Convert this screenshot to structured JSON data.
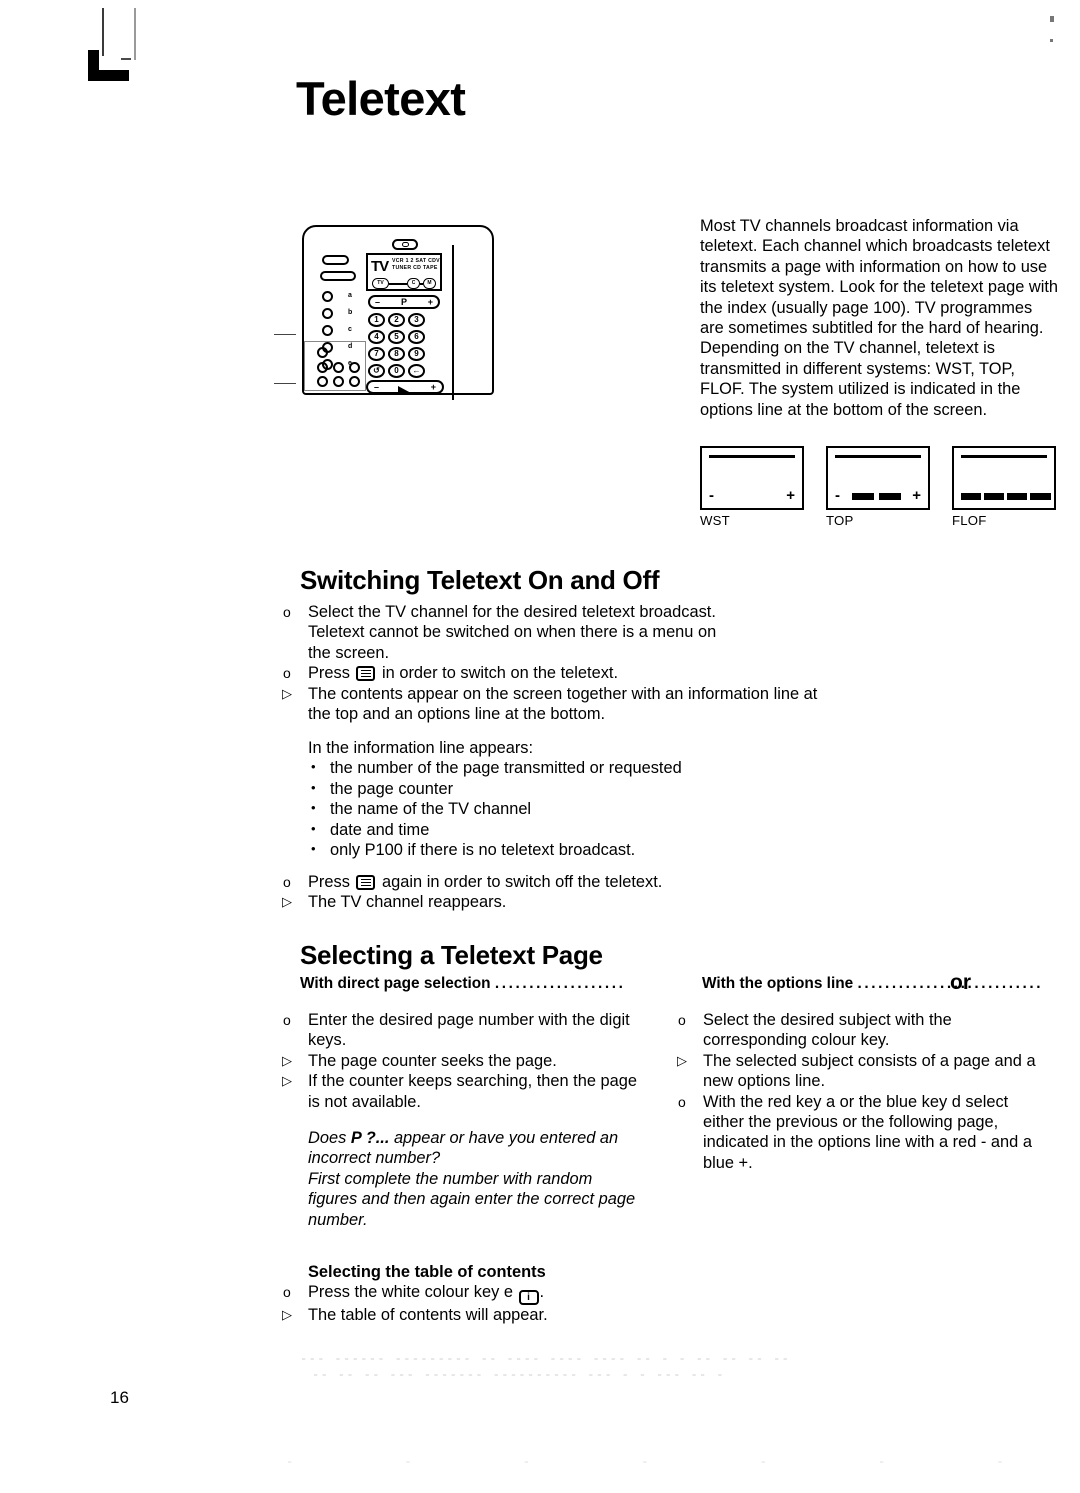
{
  "document": {
    "title": "Teletext",
    "page_number": "16"
  },
  "remote": {
    "source_tv": "TV",
    "source_line1": "VCR 1 2  SAT CDV",
    "source_line2": "TUNER   CD   TAPE",
    "pill_tv": "TV",
    "pill_c": "C",
    "pill_m": "M",
    "program_minus": "–",
    "program_label": "P",
    "program_plus": "+",
    "keys": [
      "1",
      "2",
      "3",
      "4",
      "5",
      "6",
      "7",
      "8",
      "9",
      "↺",
      "0",
      "←"
    ],
    "left_labels": [
      "a",
      "b",
      "c",
      "d",
      "e"
    ],
    "volume_minus": "–",
    "volume_plus": "+"
  },
  "intro": {
    "paragraph": "Most TV channels broadcast information via teletext. Each channel which broadcasts teletext transmits a page with information on how to use its teletext system. Look for the teletext page with the index (usually page 100). TV programmes are sometimes subtitled for the hard of hearing. Depending on the TV channel, teletext is transmitted in different systems: WST, TOP, FLOF. The system utilized is indicated in the options line at the bottom of the screen."
  },
  "systems": [
    {
      "label": "WST",
      "minus": "-",
      "plus": "+",
      "bars": 0
    },
    {
      "label": "TOP",
      "minus": "-",
      "plus": "+",
      "bars": 2
    },
    {
      "label": "FLOF",
      "minus": "",
      "plus": "",
      "bars": 4
    }
  ],
  "switching": {
    "heading": "Switching Teletext On and Off",
    "item1_marker": "o",
    "item1_line1": "Select the TV channel for the desired teletext broadcast.",
    "item1_line2": "Teletext cannot be switched on when there is a menu on",
    "item1_line3": "the screen.",
    "item2_marker": "o",
    "item2_pre": "Press",
    "item2_post": "in order to switch on the teletext.",
    "item3_marker": "▷",
    "item3_line1": "The contents appear on the screen together with an information line at",
    "item3_line2": "the top and an options line at the bottom.",
    "info_intro": "In the information line appears:",
    "info_bullets": [
      "the number of the page transmitted or requested",
      "the page counter",
      "the name of the TV channel",
      "date and time",
      "only P100 if there is no teletext broadcast."
    ],
    "item4_marker": "o",
    "item4_pre": "Press",
    "item4_post": "again in order to switch off the teletext.",
    "item5_marker": "▷",
    "item5_text": "The TV channel reappears."
  },
  "selecting": {
    "heading": "Selecting a Teletext Page",
    "col_left_header": "With direct page selection",
    "col_left_dots": "...................",
    "or": "or",
    "col_right_header": "With the options line",
    "col_right_dots": "...........................",
    "left_items": [
      {
        "marker": "o",
        "line1": "Enter the desired page number with the digit",
        "line2": "keys."
      },
      {
        "marker": "▷",
        "line1": "The page counter seeks the page.",
        "line2": ""
      },
      {
        "marker": "▷",
        "line1": "If the counter keeps searching, then the page",
        "line2": "is not available."
      }
    ],
    "right_items": [
      {
        "marker": "o",
        "line1": "Select the desired subject with the",
        "line2": "corresponding colour key.",
        "line3": "",
        "line4": ""
      },
      {
        "marker": "▷",
        "line1": "The selected subject consists of a page and a",
        "line2": "new options line.",
        "line3": "",
        "line4": ""
      },
      {
        "marker": "o",
        "line1": "With the red key a or the blue key d select",
        "line2": "either the previous or the following page,",
        "line3": "indicated in the options line with a red - and a",
        "line4": "blue +."
      }
    ],
    "note_line1_pre": "Does ",
    "note_line1_bold": "P ?...",
    "note_line1_post": " appear or have you entered an",
    "note_line2": "incorrect number?",
    "note_line3": "First complete the number with random",
    "note_line4": "figures and then again enter the correct page",
    "note_line5": "number."
  },
  "table_of_contents": {
    "heading": "Selecting the table of contents",
    "item1_marker": "o",
    "item1_pre": "Press the white colour key e",
    "item1_icon_label": "i",
    "item1_post": ".",
    "item2_marker": "▷",
    "item2_text": "The table of contents will appear."
  },
  "artifacts": {
    "ghost_line1": "---  ------   ---------  --  ----   ---- ---- -- - - -- --   -- --",
    "ghost_line2": "-- -- -- --- -------  ---------- --- - - --- -- -",
    "ghost_line3": "- - - - - - -"
  }
}
